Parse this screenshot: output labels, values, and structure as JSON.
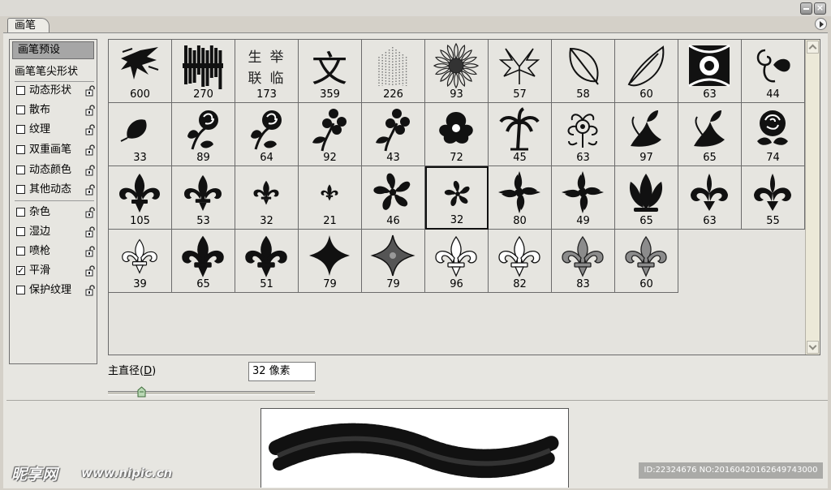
{
  "window": {
    "minimize_icon": "minimize-icon",
    "close_icon": "close-icon",
    "close_glyph": "×"
  },
  "tab": {
    "label": "画笔",
    "menu_icon": "panel-menu-arrow-icon"
  },
  "sidebar": {
    "header": "画笔预设",
    "tip_shape": "画笔笔尖形状",
    "items": [
      {
        "label": "动态形状",
        "checked": false
      },
      {
        "label": "散布",
        "checked": false
      },
      {
        "label": "纹理",
        "checked": false
      },
      {
        "label": "双重画笔",
        "checked": false
      },
      {
        "label": "动态颜色",
        "checked": false
      },
      {
        "label": "其他动态",
        "checked": false
      },
      {
        "label": "杂色",
        "checked": false
      },
      {
        "label": "湿边",
        "checked": false
      },
      {
        "label": "喷枪",
        "checked": false
      },
      {
        "label": "平滑",
        "checked": true
      },
      {
        "label": "保护纹理",
        "checked": false
      }
    ],
    "check_glyph": "✓",
    "lock_icon": "lock-icon"
  },
  "brushes": [
    {
      "size": "600",
      "icon": "scatter-splash-brush-icon"
    },
    {
      "size": "270",
      "icon": "grunge-crowd-brush-icon"
    },
    {
      "size": "173",
      "icon": "calligraphy-text-brush-icon",
      "glyphs": [
        "生",
        "举",
        "联",
        "临"
      ]
    },
    {
      "size": "359",
      "icon": "calligraphy-wen-brush-icon",
      "glyphs": [
        "文"
      ]
    },
    {
      "size": "226",
      "icon": "dotted-lines-brush-icon"
    },
    {
      "size": "93",
      "icon": "sunflower-brush-icon"
    },
    {
      "size": "57",
      "icon": "maple-leaf-brush-icon"
    },
    {
      "size": "58",
      "icon": "leaf-outline-brush-icon"
    },
    {
      "size": "60",
      "icon": "oak-leaf-brush-icon"
    },
    {
      "size": "63",
      "icon": "ornate-tile-brush-icon"
    },
    {
      "size": "44",
      "icon": "swirl-leaf-brush-icon"
    },
    {
      "size": "33",
      "icon": "small-leaf-brush-icon"
    },
    {
      "size": "89",
      "icon": "rose-branch-brush-icon"
    },
    {
      "size": "64",
      "icon": "rose-branch-brush-icon"
    },
    {
      "size": "92",
      "icon": "flower-stem-brush-icon"
    },
    {
      "size": "43",
      "icon": "flower-stem-brush-icon"
    },
    {
      "size": "72",
      "icon": "ornate-flower-brush-icon"
    },
    {
      "size": "45",
      "icon": "palm-tree-brush-icon"
    },
    {
      "size": "63",
      "icon": "baroque-flower-brush-icon"
    },
    {
      "size": "97",
      "icon": "leafy-plant-brush-icon"
    },
    {
      "size": "65",
      "icon": "leafy-plant-brush-icon"
    },
    {
      "size": "74",
      "icon": "rose-bloom-brush-icon"
    },
    {
      "size": "105",
      "icon": "fleur-de-lis-brush-icon"
    },
    {
      "size": "53",
      "icon": "fleur-de-lis-brush-icon"
    },
    {
      "size": "32",
      "icon": "fleur-de-lis-brush-icon"
    },
    {
      "size": "21",
      "icon": "fleur-de-lis-brush-icon"
    },
    {
      "size": "46",
      "icon": "pinwheel-brush-icon"
    },
    {
      "size": "32",
      "icon": "pinwheel-brush-icon",
      "selected": true
    },
    {
      "size": "80",
      "icon": "damask-cross-brush-icon"
    },
    {
      "size": "49",
      "icon": "damask-cross-brush-icon"
    },
    {
      "size": "65",
      "icon": "fan-scroll-brush-icon"
    },
    {
      "size": "63",
      "icon": "scroll-crown-brush-icon"
    },
    {
      "size": "55",
      "icon": "scroll-crown-brush-icon"
    },
    {
      "size": "39",
      "icon": "fleur-outline-brush-icon"
    },
    {
      "size": "65",
      "icon": "fleur-heavy-brush-icon"
    },
    {
      "size": "51",
      "icon": "fleur-heavy-brush-icon"
    },
    {
      "size": "79",
      "icon": "four-point-star-brush-icon"
    },
    {
      "size": "79",
      "icon": "four-point-star-brush-icon"
    },
    {
      "size": "96",
      "icon": "fleur-outline-brush-icon"
    },
    {
      "size": "82",
      "icon": "fleur-outline-brush-icon"
    },
    {
      "size": "83",
      "icon": "fleur-gray-brush-icon"
    },
    {
      "size": "60",
      "icon": "fleur-gray-brush-icon"
    }
  ],
  "diameter": {
    "label_prefix": "主直径(",
    "label_key": "D",
    "label_suffix": ")",
    "value": "32 像素",
    "slider_fraction": 0.16
  },
  "watermark": {
    "logo": "昵享网",
    "url": "www.nipic.cn",
    "id": "ID:22324676 NO:20160420162649743000"
  }
}
